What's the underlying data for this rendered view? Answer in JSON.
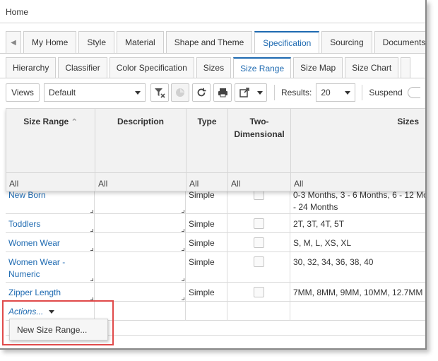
{
  "home": {
    "label": "Home"
  },
  "main_tabs": [
    {
      "label": "My Home",
      "active": false
    },
    {
      "label": "Style",
      "active": false
    },
    {
      "label": "Material",
      "active": false
    },
    {
      "label": "Shape and Theme",
      "active": false
    },
    {
      "label": "Specification",
      "active": true
    },
    {
      "label": "Sourcing",
      "active": false
    },
    {
      "label": "Documents",
      "active": false
    }
  ],
  "sub_tabs": [
    {
      "label": "Hierarchy",
      "active": false
    },
    {
      "label": "Classifier",
      "active": false
    },
    {
      "label": "Color Specification",
      "active": false
    },
    {
      "label": "Sizes",
      "active": false
    },
    {
      "label": "Size Range",
      "active": true
    },
    {
      "label": "Size Map",
      "active": false
    },
    {
      "label": "Size Chart",
      "active": false
    }
  ],
  "toolbar": {
    "views_label": "Views",
    "view_value": "Default",
    "results_label": "Results:",
    "results_value": "20",
    "suspend_label": "Suspend"
  },
  "columns": [
    {
      "title": "Size Range",
      "filter": "All"
    },
    {
      "title": "Description",
      "filter": "All"
    },
    {
      "title": "Type",
      "filter": "All"
    },
    {
      "title": "Two-\nDimensional",
      "filter": "All"
    },
    {
      "title": "Sizes",
      "filter": "All"
    }
  ],
  "rows": [
    {
      "name": "New Born",
      "type": "Simple",
      "sizes": "0-3 Months, 3 - 6 Months, 6 - 12 Mo\n- 24 Months"
    },
    {
      "name": "Toddlers",
      "type": "Simple",
      "sizes": "2T, 3T, 4T, 5T"
    },
    {
      "name": "Women Wear",
      "type": "Simple",
      "sizes": "S, M, L, XS, XL"
    },
    {
      "name": "Women Wear -\nNumeric",
      "type": "Simple",
      "sizes": "30, 32, 34, 36, 38, 40"
    },
    {
      "name": "Zipper Length",
      "type": "Simple",
      "sizes": "7MM, 8MM, 9MM, 10MM, 12.7MM"
    }
  ],
  "actions": {
    "label": "Actions...",
    "menu_item": "New Size Range..."
  },
  "colors": {
    "accent": "#1e6ab1",
    "highlight": "#e04a4a"
  }
}
